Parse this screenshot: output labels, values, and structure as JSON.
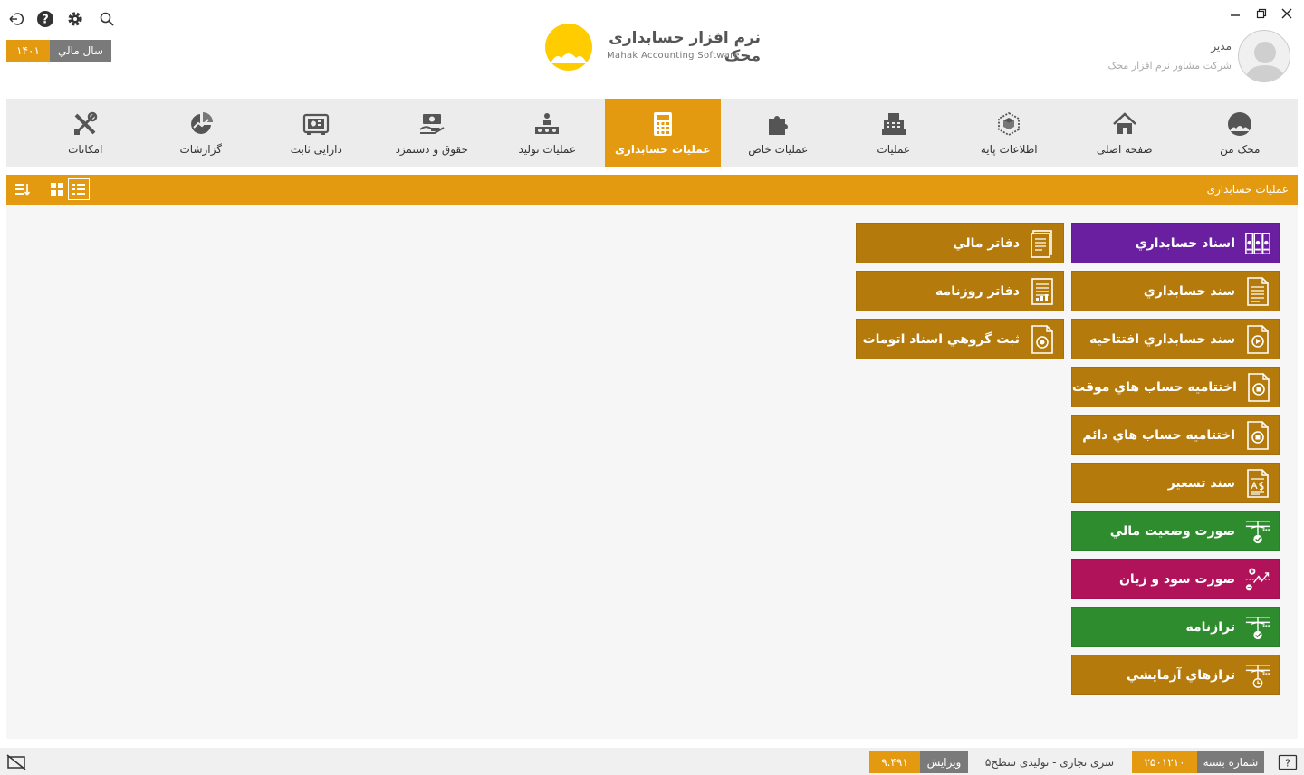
{
  "window": {
    "close_icon": "close-icon",
    "restore_icon": "restore-icon",
    "minimize_icon": "minimize-icon"
  },
  "topbar": {
    "fiscal_year_label": "سال مالي",
    "fiscal_year_value": "۱۴۰۱"
  },
  "logo": {
    "title": "نرم افزار حسابداری محک",
    "subtitle": "Mahak Accounting Software"
  },
  "user": {
    "name": "مدیر",
    "company": "شرکت مشاور نرم افزار محک"
  },
  "nav": {
    "items": [
      {
        "label": "محک من",
        "icon": "mahak-icon"
      },
      {
        "label": "صفحه اصلی",
        "icon": "home-icon"
      },
      {
        "label": "اطلاعات پایه",
        "icon": "box-icon"
      },
      {
        "label": "عملیات",
        "icon": "cash-register-icon"
      },
      {
        "label": "عملیات خاص",
        "icon": "puzzle-icon"
      },
      {
        "label": "عملیات حسابداری",
        "icon": "calculator-icon"
      },
      {
        "label": "عملیات تولید",
        "icon": "factory-icon"
      },
      {
        "label": "حقوق و دستمزد",
        "icon": "salary-icon"
      },
      {
        "label": "دارایی ثابت",
        "icon": "safe-icon"
      },
      {
        "label": "گزارشات",
        "icon": "report-icon"
      },
      {
        "label": "امکانات",
        "icon": "tools-icon"
      }
    ],
    "active_index": 5
  },
  "section": {
    "title": "عملیات حسابداری"
  },
  "tiles_right": [
    {
      "label": "اسناد حسابداري",
      "color": "#6a1fa1"
    },
    {
      "label": "سند حسابداري",
      "color": "#b47a0c"
    },
    {
      "label": "سند حسابداري افتتاحيه",
      "color": "#b47a0c"
    },
    {
      "label": "اختتاميه حساب هاي موقت",
      "color": "#b47a0c"
    },
    {
      "label": "اختتاميه حساب هاي دائم",
      "color": "#b47a0c"
    },
    {
      "label": "سند تسعير",
      "color": "#b47a0c"
    },
    {
      "label": "صورت وضعيت مالي",
      "color": "#2e8b2e"
    },
    {
      "label": "صورت سود و زيان",
      "color": "#b0135a"
    },
    {
      "label": "ترازنامه",
      "color": "#2e8b2e"
    },
    {
      "label": "ترازهاي آزمايشي",
      "color": "#b47a0c"
    }
  ],
  "tiles_left": [
    {
      "label": "دفاتر مالي",
      "color": "#b47a0c"
    },
    {
      "label": "دفاتر روزنامه",
      "color": "#b47a0c"
    },
    {
      "label": "ثبت گروهي اسناد اتومات",
      "color": "#b47a0c"
    }
  ],
  "status": {
    "package_label": "شماره بسته",
    "package_value": "۲۵۰۱۲۱۰",
    "series_text": "سری تجاری - تولیدی سطح۵",
    "version_label": "ویرایش",
    "version_value": "۹.۴۹۱"
  }
}
